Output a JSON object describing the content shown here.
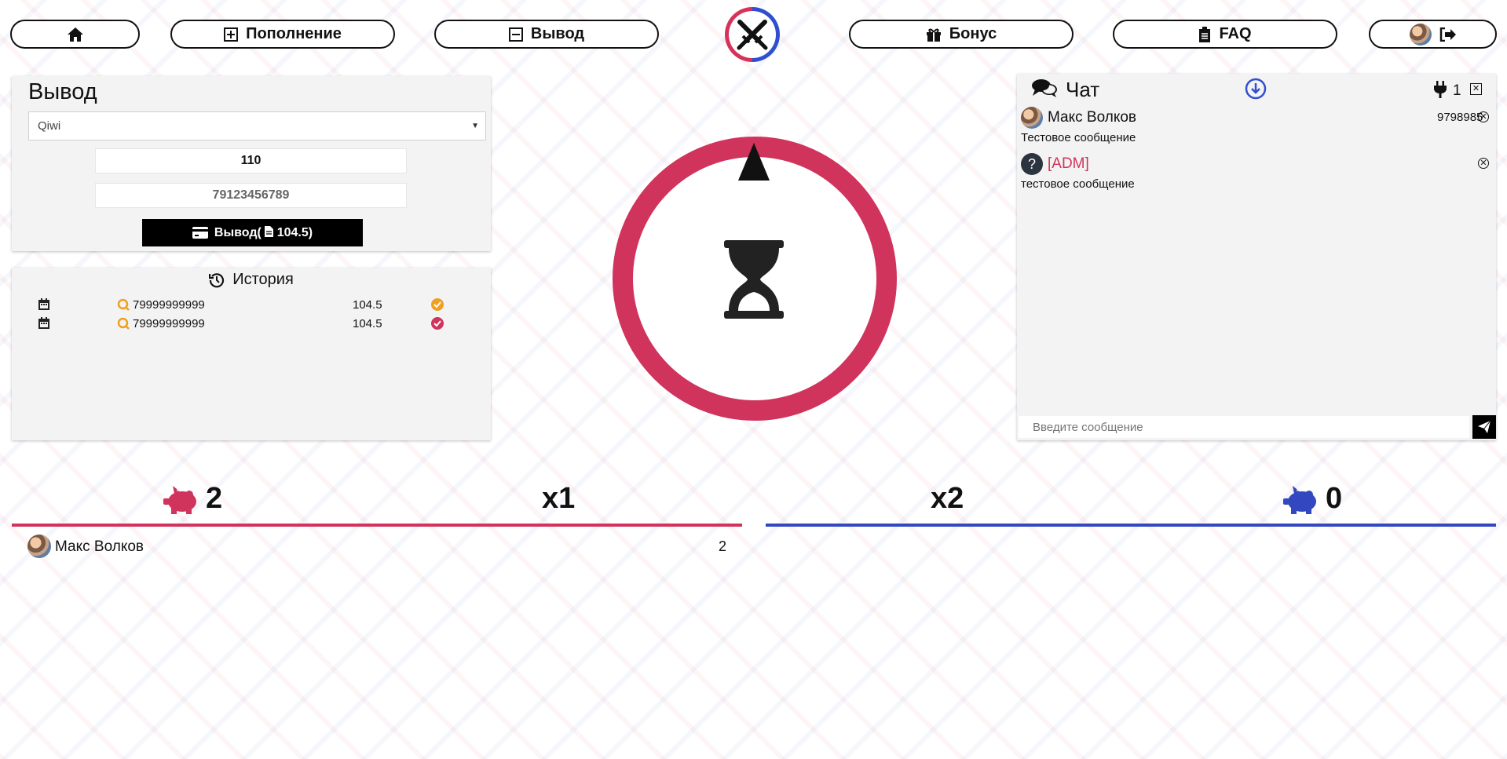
{
  "colors": {
    "red": "#d0335b",
    "blue": "#3347c0",
    "orange": "#f0a020",
    "panel": "#f3f3f3"
  },
  "nav": {
    "home_icon": "home-icon",
    "deposit_label": "Пополнение",
    "withdraw_label": "Вывод",
    "bonus_label": "Бонус",
    "faq_label": "FAQ",
    "logout_icon": "logout-icon"
  },
  "withdraw": {
    "title": "Вывод",
    "method": "Qiwi",
    "amount": "110",
    "wallet": "79123456789",
    "button_label": "Вывод(",
    "button_amount": "104.5)"
  },
  "history": {
    "title": "История",
    "rows": [
      {
        "phone": "79999999999",
        "amount": "104.5",
        "status": "pending"
      },
      {
        "phone": "79999999999",
        "amount": "104.5",
        "status": "done"
      }
    ]
  },
  "chat": {
    "title": "Чат",
    "online_count": "1",
    "input_placeholder": "Введите сообщение",
    "messages": [
      {
        "name": "Макс Волков",
        "id": "9798985",
        "text": "Тестовое сообщение"
      },
      {
        "name": "[ADM]",
        "id": "",
        "text": "тестовое сообщение"
      }
    ]
  },
  "game": {
    "red_count": "2",
    "red_multiplier": "x1",
    "blue_multiplier": "x2",
    "blue_count": "0",
    "red_players": [
      {
        "name": "Макс Волков",
        "bet": "2"
      }
    ]
  }
}
